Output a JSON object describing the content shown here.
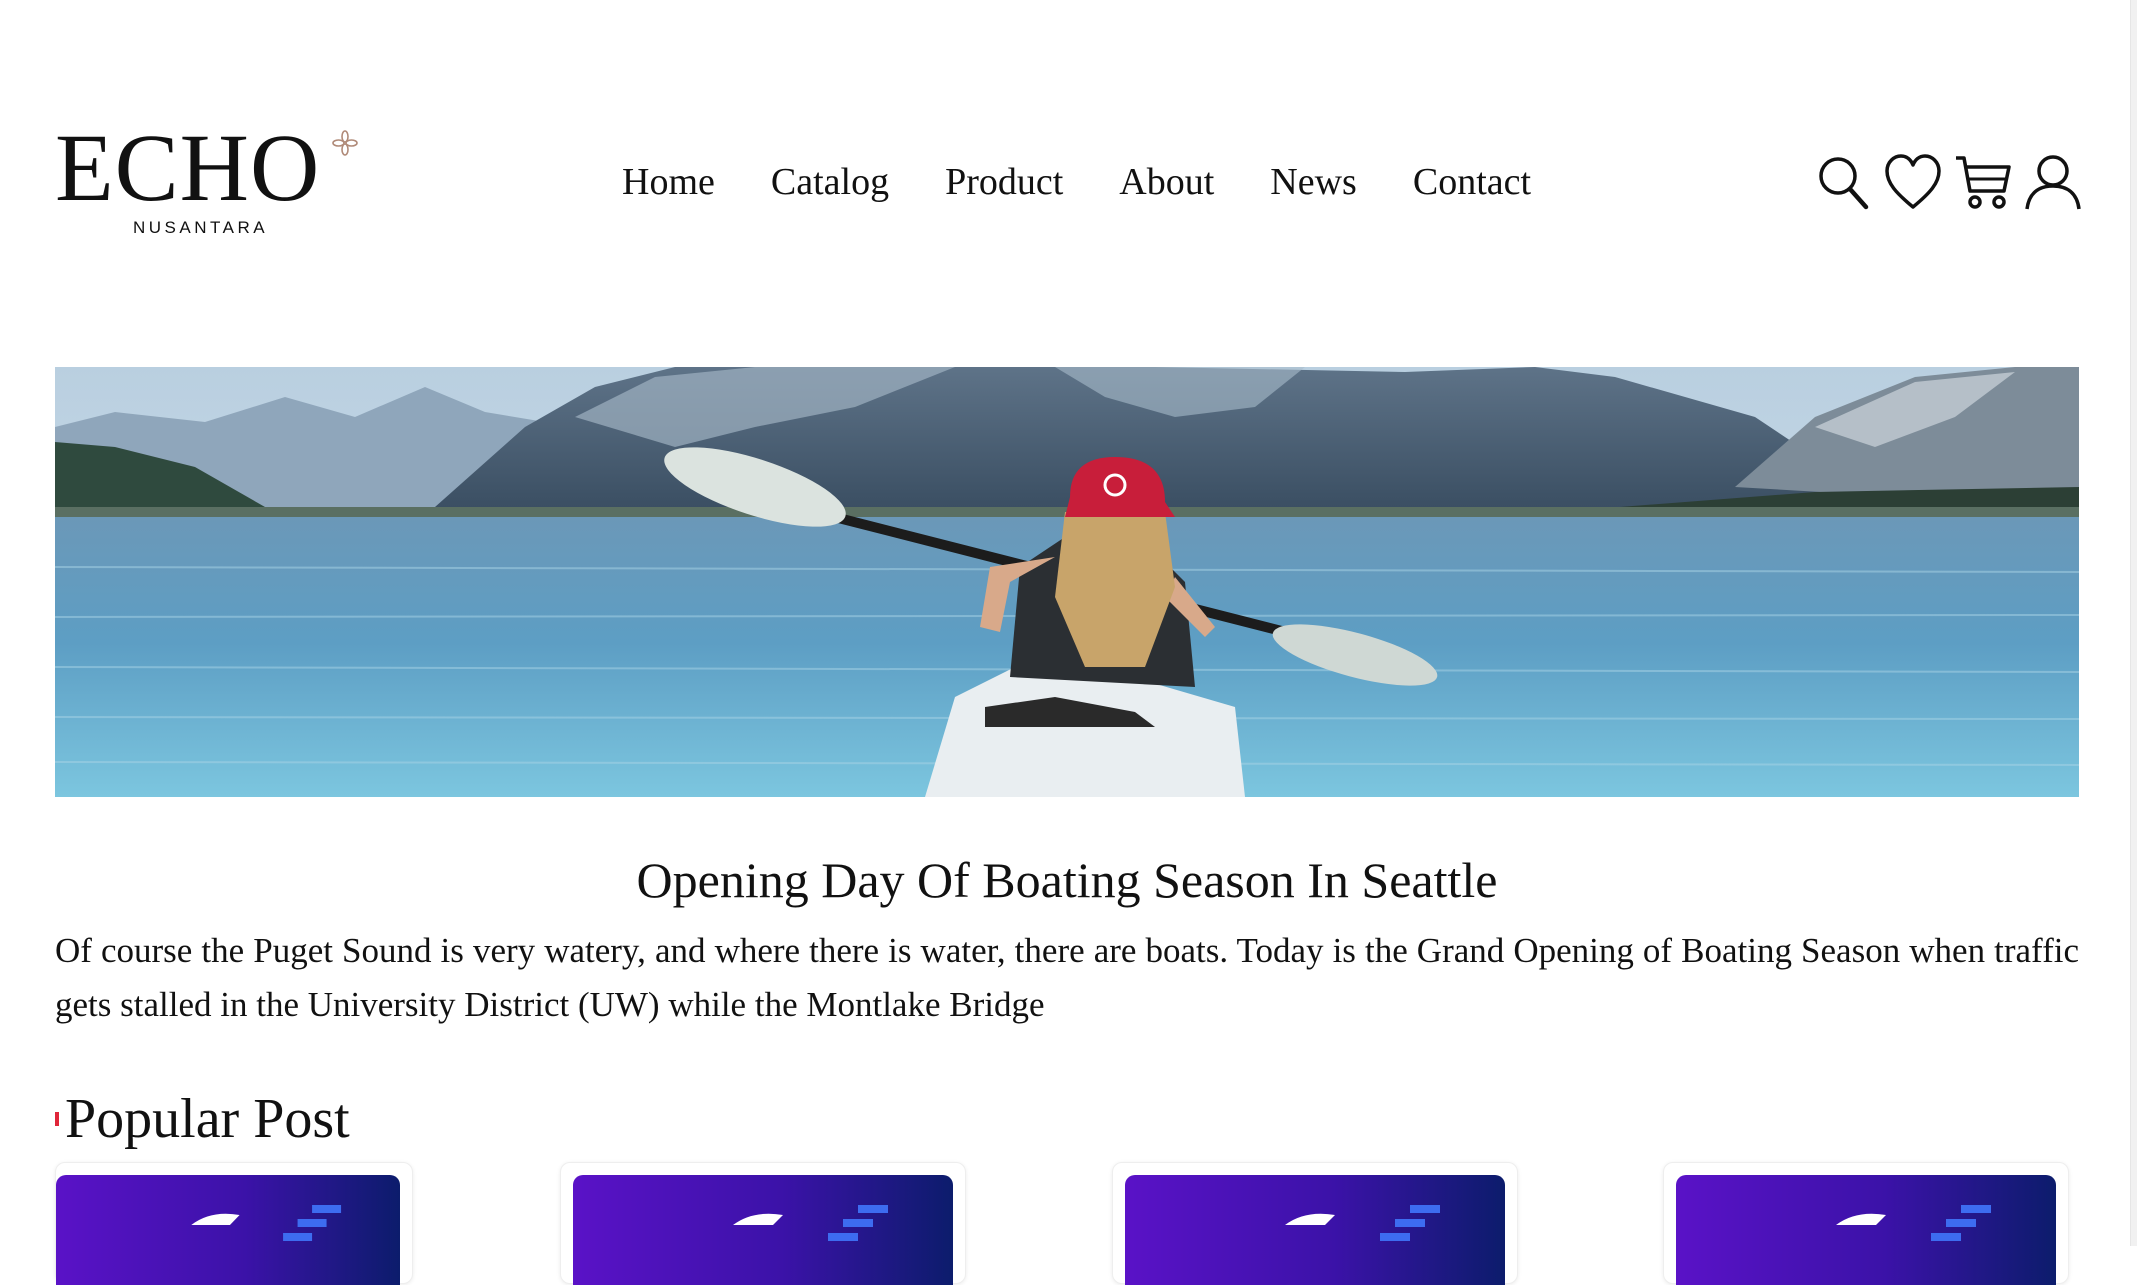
{
  "brand": {
    "name": "ECHO",
    "tagline": "NUSANTARA",
    "accent": "#b08a78"
  },
  "nav": {
    "items": [
      "Home",
      "Catalog",
      "Product",
      "About",
      "News",
      "Contact"
    ]
  },
  "header_icons": [
    "search-icon",
    "heart-icon",
    "cart-icon",
    "user-icon"
  ],
  "hero": {
    "image": "kayaker-on-mountain-lake-photo"
  },
  "article": {
    "title": "Opening Day Of Boating Season In Seattle",
    "body": "Of course the Puget Sound is very watery, and where there is water, there are boats. Today is the Grand Opening of Boating Season when traffic gets stalled in the University District (UW) while the Montlake Bridge"
  },
  "popular": {
    "heading": "Popular Post",
    "marker_color": "#e0263a",
    "cards": [
      {
        "thumb": "purple-laptop-thumbnail"
      },
      {
        "thumb": "purple-laptop-thumbnail"
      },
      {
        "thumb": "purple-laptop-thumbnail"
      },
      {
        "thumb": "purple-laptop-thumbnail"
      }
    ]
  }
}
